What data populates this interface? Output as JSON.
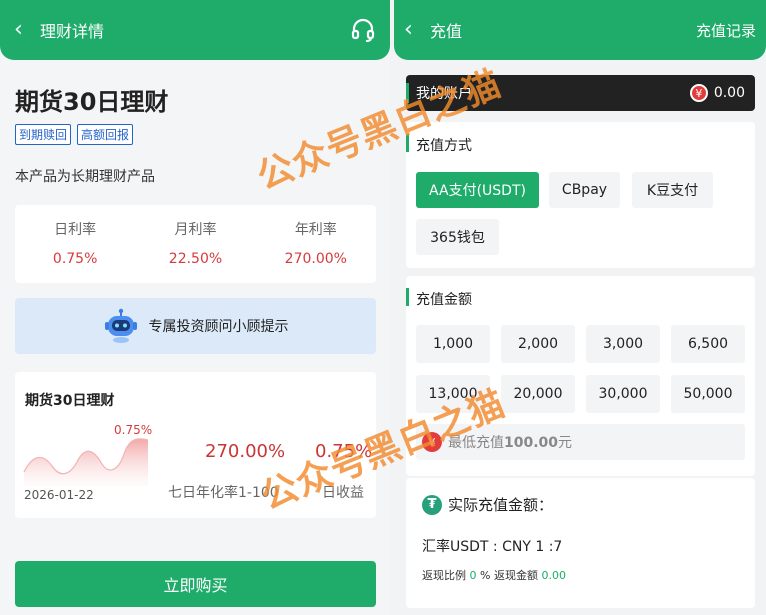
{
  "left": {
    "nav_title": "理财详情",
    "product_title_a": "期货",
    "product_title_b": "30",
    "product_title_c": "日理财",
    "tags": [
      "到期赎回",
      "高额回报"
    ],
    "description": "本产品为长期理财产品",
    "rates": [
      {
        "label": "日利率",
        "value": "0.75%"
      },
      {
        "label": "月利率",
        "value": "22.50%"
      },
      {
        "label": "年利率",
        "value": "270.00%"
      }
    ],
    "advisor_text": "专属投资顾问小顾提示",
    "card_title_a": "期货",
    "card_title_b": "30",
    "card_title_c": "日理财",
    "spark_pct": "0.75%",
    "date": "2026-01-22",
    "seven_day_value": "270.00%",
    "daily_value": "0.75%",
    "seven_day_label": "七日年化率1-100",
    "daily_label": "日收益",
    "buy_label": "立即购买"
  },
  "right": {
    "nav_title": "充值",
    "history_link": "充值记录",
    "account_label": "我的账户",
    "account_value": "0.00",
    "coin_symbol": "¥",
    "method_title": "充值方式",
    "methods": [
      "AA支付(USDT)",
      "CBpay",
      "K豆支付",
      "365钱包"
    ],
    "amount_title": "充值金额",
    "amounts": [
      "1,000",
      "2,000",
      "3,000",
      "6,500",
      "13,000",
      "20,000",
      "30,000",
      "50,000"
    ],
    "min_prefix": "最低充值",
    "min_value": "100.00",
    "min_suffix": "元",
    "actual_label": "实际充值金额：",
    "exchange_rate": "汇率USDT : CNY 1 :7",
    "rebate_ratio_label": "返现比例",
    "rebate_ratio_value": "0",
    "rebate_ratio_unit": "%",
    "rebate_amount_label": "返现金额",
    "rebate_amount_value": "0.00"
  },
  "watermark": "公众号黑白之猫",
  "colors": {
    "brand_green": "#1fac6a",
    "rate_red": "#d63c3c",
    "tag_blue": "#2463c9"
  }
}
